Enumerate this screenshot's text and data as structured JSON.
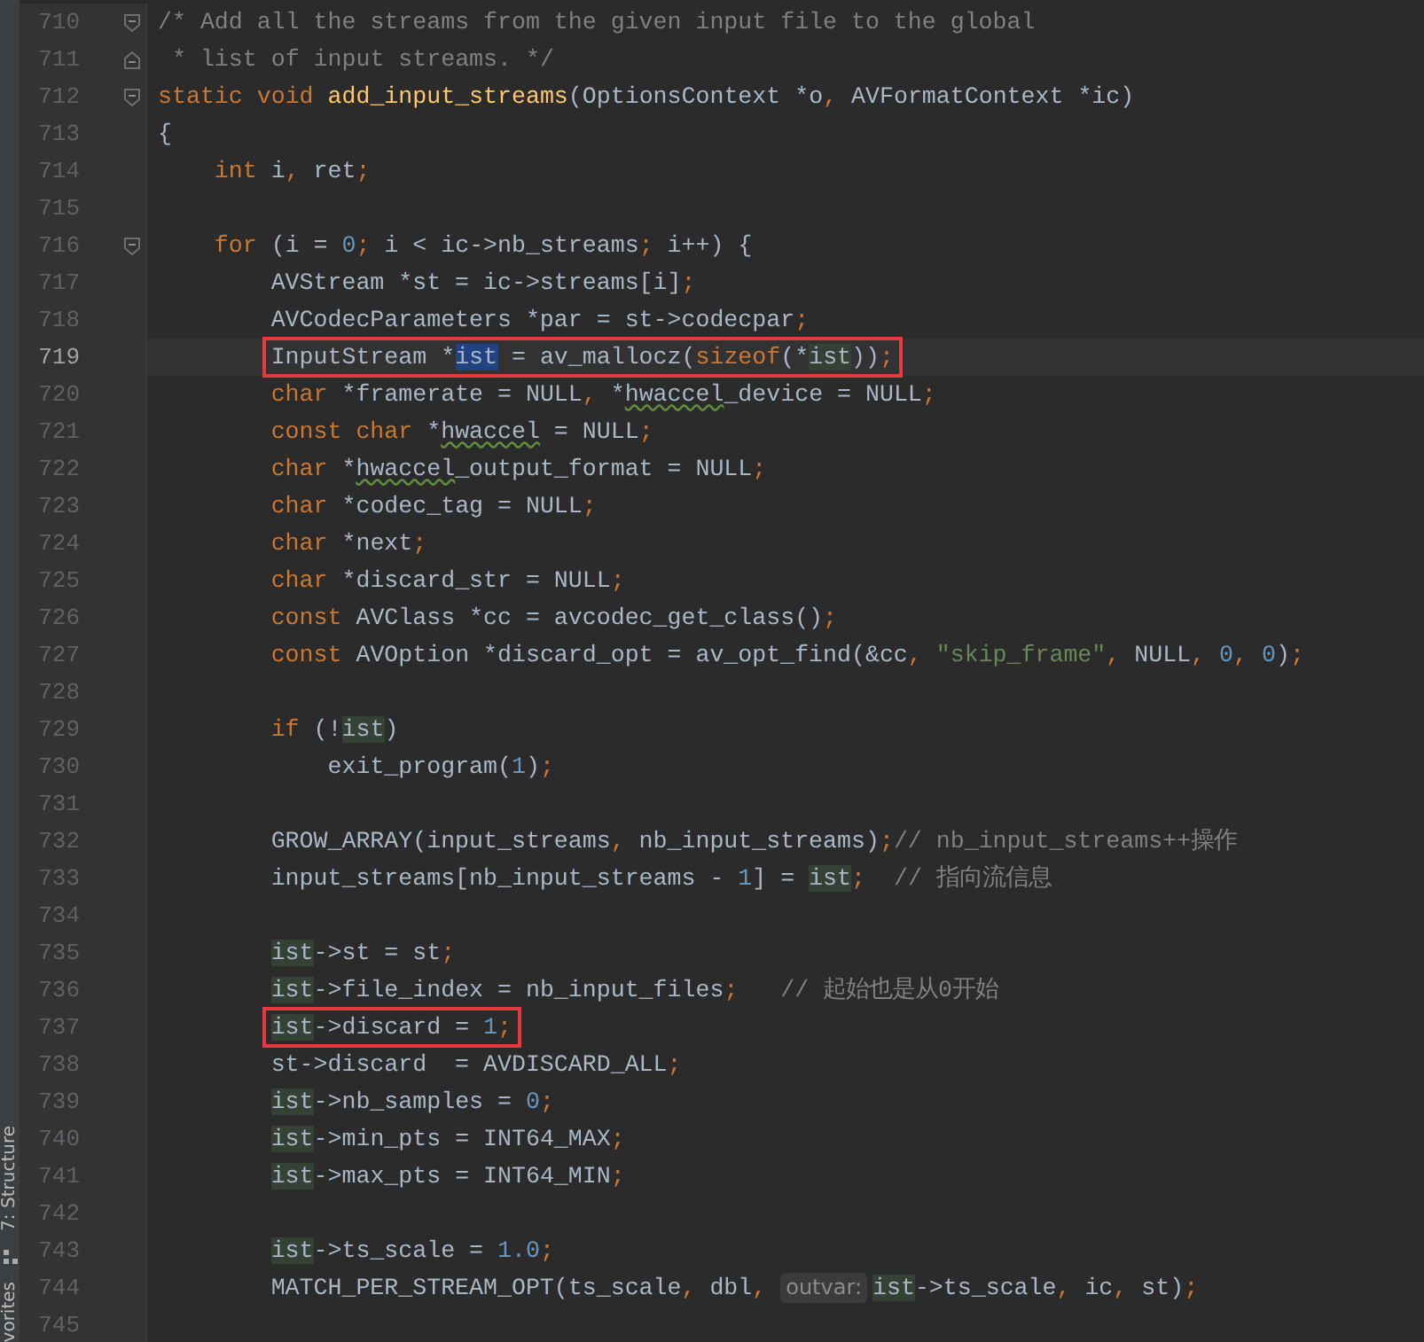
{
  "tool_strip": {
    "tabs": [
      {
        "label": "7: Structure",
        "kind": "structure"
      },
      {
        "label": "vorites",
        "kind": "plain"
      }
    ]
  },
  "lines": [
    {
      "number": "710",
      "fold_start": true,
      "tokens": [
        {
          "t": "/* Add all the streams from the given input file to the global",
          "kind": "comment"
        }
      ]
    },
    {
      "number": "711",
      "fold_end": true,
      "tokens": [
        {
          "t": " * list of input streams. */",
          "kind": "comment"
        }
      ]
    },
    {
      "number": "712",
      "fold_start": true,
      "tokens": [
        {
          "t": "static void",
          "kind": "keyword"
        },
        {
          "t": " add_input_streams",
          "kind": "function"
        },
        {
          "t": "(OptionsContext *o",
          "kind": "plain"
        },
        {
          "t": ", ",
          "kind": "punct"
        },
        {
          "t": "AVFormatContext *ic)",
          "kind": "plain"
        }
      ]
    },
    {
      "number": "713",
      "tokens": [
        {
          "t": "{",
          "kind": "plain"
        }
      ],
      "children": [
        {
          "number": "714",
          "tokens": [
            {
              "t": "int",
              "kind": "keyword"
            },
            {
              "t": " i",
              "kind": "plain"
            },
            {
              "t": ",",
              "kind": "punct"
            },
            {
              "t": " ret",
              "kind": "plain"
            },
            {
              "t": ";",
              "kind": "punct"
            }
          ]
        },
        {
          "number": "715"
        },
        {
          "number": "716",
          "fold_start": true,
          "tokens": [
            {
              "t": "for",
              "kind": "keyword"
            },
            {
              "t": " (i = ",
              "kind": "plain"
            },
            {
              "t": "0",
              "kind": "number"
            },
            {
              "t": ";",
              "kind": "punct"
            },
            {
              "t": " i < ic->nb_streams",
              "kind": "plain"
            },
            {
              "t": ";",
              "kind": "punct"
            },
            {
              "t": " i++) {",
              "kind": "plain"
            }
          ],
          "children": [
            {
              "number": "717",
              "tokens": [
                {
                  "t": "AVStream *st = ic->streams[i]",
                  "kind": "plain"
                },
                {
                  "t": ";",
                  "kind": "punct"
                }
              ]
            },
            {
              "number": "718",
              "tokens": [
                {
                  "t": "AVCodecParameters *par = st->codecpar",
                  "kind": "plain"
                },
                {
                  "t": ";",
                  "kind": "punct"
                }
              ]
            },
            {
              "number": "719",
              "current": true,
              "boxed": true,
              "tokens": [
                {
                  "t": "InputStream *",
                  "kind": "plain"
                },
                {
                  "t": "ist",
                  "kind": "selected"
                },
                {
                  "t": " = av_mallocz(",
                  "kind": "plain"
                },
                {
                  "t": "sizeof",
                  "kind": "keyword"
                },
                {
                  "t": "(*",
                  "kind": "plain"
                },
                {
                  "t": "ist",
                  "kind": "usage"
                },
                {
                  "t": "))",
                  "kind": "plain"
                },
                {
                  "t": ";",
                  "kind": "punct"
                }
              ]
            },
            {
              "number": "720",
              "tokens": [
                {
                  "t": "char",
                  "kind": "keyword"
                },
                {
                  "t": " *framerate = NULL",
                  "kind": "plain"
                },
                {
                  "t": ",",
                  "kind": "punct"
                },
                {
                  "t": " *",
                  "kind": "plain"
                },
                {
                  "t": "hwaccel",
                  "kind": "typo"
                },
                {
                  "t": "_device = NULL",
                  "kind": "plain"
                },
                {
                  "t": ";",
                  "kind": "punct"
                }
              ]
            },
            {
              "number": "721",
              "tokens": [
                {
                  "t": "const char",
                  "kind": "keyword"
                },
                {
                  "t": " *",
                  "kind": "plain"
                },
                {
                  "t": "hwaccel",
                  "kind": "typo"
                },
                {
                  "t": " = NULL",
                  "kind": "plain"
                },
                {
                  "t": ";",
                  "kind": "punct"
                }
              ]
            },
            {
              "number": "722",
              "tokens": [
                {
                  "t": "char",
                  "kind": "keyword"
                },
                {
                  "t": " *",
                  "kind": "plain"
                },
                {
                  "t": "hwaccel",
                  "kind": "typo"
                },
                {
                  "t": "_output_format = NULL",
                  "kind": "plain"
                },
                {
                  "t": ";",
                  "kind": "punct"
                }
              ]
            },
            {
              "number": "723",
              "tokens": [
                {
                  "t": "char",
                  "kind": "keyword"
                },
                {
                  "t": " *codec_tag = NULL",
                  "kind": "plain"
                },
                {
                  "t": ";",
                  "kind": "punct"
                }
              ]
            },
            {
              "number": "724",
              "tokens": [
                {
                  "t": "char",
                  "kind": "keyword"
                },
                {
                  "t": " *next",
                  "kind": "plain"
                },
                {
                  "t": ";",
                  "kind": "punct"
                }
              ]
            },
            {
              "number": "725",
              "tokens": [
                {
                  "t": "char",
                  "kind": "keyword"
                },
                {
                  "t": " *discard_str = NULL",
                  "kind": "plain"
                },
                {
                  "t": ";",
                  "kind": "punct"
                }
              ]
            },
            {
              "number": "726",
              "tokens": [
                {
                  "t": "const",
                  "kind": "keyword"
                },
                {
                  "t": " AVClass *cc = avcodec_get_class()",
                  "kind": "plain"
                },
                {
                  "t": ";",
                  "kind": "punct"
                }
              ]
            },
            {
              "number": "727",
              "tokens": [
                {
                  "t": "const",
                  "kind": "keyword"
                },
                {
                  "t": " AVOption *discard_opt = av_opt_find(&cc",
                  "kind": "plain"
                },
                {
                  "t": ", ",
                  "kind": "punct"
                },
                {
                  "t": "\"skip_frame\"",
                  "kind": "string"
                },
                {
                  "t": ",",
                  "kind": "punct"
                },
                {
                  "t": " NULL",
                  "kind": "plain"
                },
                {
                  "t": ", ",
                  "kind": "punct"
                },
                {
                  "t": "0",
                  "kind": "number"
                },
                {
                  "t": ", ",
                  "kind": "punct"
                },
                {
                  "t": "0",
                  "kind": "number"
                },
                {
                  "t": ")",
                  "kind": "plain"
                },
                {
                  "t": ";",
                  "kind": "punct"
                }
              ]
            },
            {
              "number": "728"
            },
            {
              "number": "729",
              "tokens": [
                {
                  "t": "if",
                  "kind": "keyword"
                },
                {
                  "t": " (!",
                  "kind": "plain"
                },
                {
                  "t": "ist",
                  "kind": "usage"
                },
                {
                  "t": ")",
                  "kind": "plain"
                }
              ],
              "children": [
                {
                  "number": "730",
                  "tokens": [
                    {
                      "t": "exit_program(",
                      "kind": "plain"
                    },
                    {
                      "t": "1",
                      "kind": "number"
                    },
                    {
                      "t": ")",
                      "kind": "plain"
                    },
                    {
                      "t": ";",
                      "kind": "punct"
                    }
                  ]
                }
              ]
            },
            {
              "number": "731"
            },
            {
              "number": "732",
              "tokens": [
                {
                  "t": "GROW_ARRAY(input_streams",
                  "kind": "plain"
                },
                {
                  "t": ",",
                  "kind": "punct"
                },
                {
                  "t": " nb_input_streams)",
                  "kind": "plain"
                },
                {
                  "t": ";",
                  "kind": "punct"
                },
                {
                  "t": "// nb_input_streams++操作",
                  "kind": "comment"
                }
              ]
            },
            {
              "number": "733",
              "tokens": [
                {
                  "t": "input_streams[nb_input_streams - ",
                  "kind": "plain"
                },
                {
                  "t": "1",
                  "kind": "number"
                },
                {
                  "t": "] = ",
                  "kind": "plain"
                },
                {
                  "t": "ist",
                  "kind": "usage"
                },
                {
                  "t": ";",
                  "kind": "punct"
                },
                {
                  "t": "  // 指向流信息",
                  "kind": "comment"
                }
              ]
            },
            {
              "number": "734"
            },
            {
              "number": "735",
              "tokens": [
                {
                  "t": "ist",
                  "kind": "usage"
                },
                {
                  "t": "->st = st",
                  "kind": "plain"
                },
                {
                  "t": ";",
                  "kind": "punct"
                }
              ]
            },
            {
              "number": "736",
              "tokens": [
                {
                  "t": "ist",
                  "kind": "usage"
                },
                {
                  "t": "->file_index = nb_input_files",
                  "kind": "plain"
                },
                {
                  "t": ";",
                  "kind": "punct"
                },
                {
                  "t": "   // 起始也是从0开始",
                  "kind": "comment"
                }
              ]
            },
            {
              "number": "737",
              "boxed": true,
              "tokens": [
                {
                  "t": "ist",
                  "kind": "usage"
                },
                {
                  "t": "->discard = ",
                  "kind": "plain"
                },
                {
                  "t": "1",
                  "kind": "number"
                },
                {
                  "t": ";",
                  "kind": "punct"
                }
              ]
            },
            {
              "number": "738",
              "tokens": [
                {
                  "t": "st->discard  = AVDISCARD_ALL",
                  "kind": "plain"
                },
                {
                  "t": ";",
                  "kind": "punct"
                }
              ]
            },
            {
              "number": "739",
              "tokens": [
                {
                  "t": "ist",
                  "kind": "usage"
                },
                {
                  "t": "->nb_samples = ",
                  "kind": "plain"
                },
                {
                  "t": "0",
                  "kind": "number"
                },
                {
                  "t": ";",
                  "kind": "punct"
                }
              ]
            },
            {
              "number": "740",
              "tokens": [
                {
                  "t": "ist",
                  "kind": "usage"
                },
                {
                  "t": "->min_pts = INT64_MAX",
                  "kind": "plain"
                },
                {
                  "t": ";",
                  "kind": "punct"
                }
              ]
            },
            {
              "number": "741",
              "tokens": [
                {
                  "t": "ist",
                  "kind": "usage"
                },
                {
                  "t": "->max_pts = INT64_MIN",
                  "kind": "plain"
                },
                {
                  "t": ";",
                  "kind": "punct"
                }
              ]
            },
            {
              "number": "742"
            },
            {
              "number": "743",
              "tokens": [
                {
                  "t": "ist",
                  "kind": "usage"
                },
                {
                  "t": "->ts_scale = ",
                  "kind": "plain"
                },
                {
                  "t": "1.0",
                  "kind": "number"
                },
                {
                  "t": ";",
                  "kind": "punct"
                }
              ]
            },
            {
              "number": "744",
              "tokens": [
                {
                  "t": "MATCH_PER_STREAM_OPT(ts_scale",
                  "kind": "plain"
                },
                {
                  "t": ",",
                  "kind": "punct"
                },
                {
                  "t": " dbl",
                  "kind": "plain"
                },
                {
                  "t": ", ",
                  "kind": "punct"
                },
                {
                  "t": "outvar:",
                  "kind": "hint"
                },
                {
                  "t": "ist",
                  "kind": "usage"
                },
                {
                  "t": "->ts_scale",
                  "kind": "plain"
                },
                {
                  "t": ",",
                  "kind": "punct"
                },
                {
                  "t": " ic",
                  "kind": "plain"
                },
                {
                  "t": ",",
                  "kind": "punct"
                },
                {
                  "t": " st)",
                  "kind": "plain"
                },
                {
                  "t": ";",
                  "kind": "punct"
                }
              ]
            },
            {
              "number": "745"
            }
          ]
        }
      ]
    }
  ]
}
